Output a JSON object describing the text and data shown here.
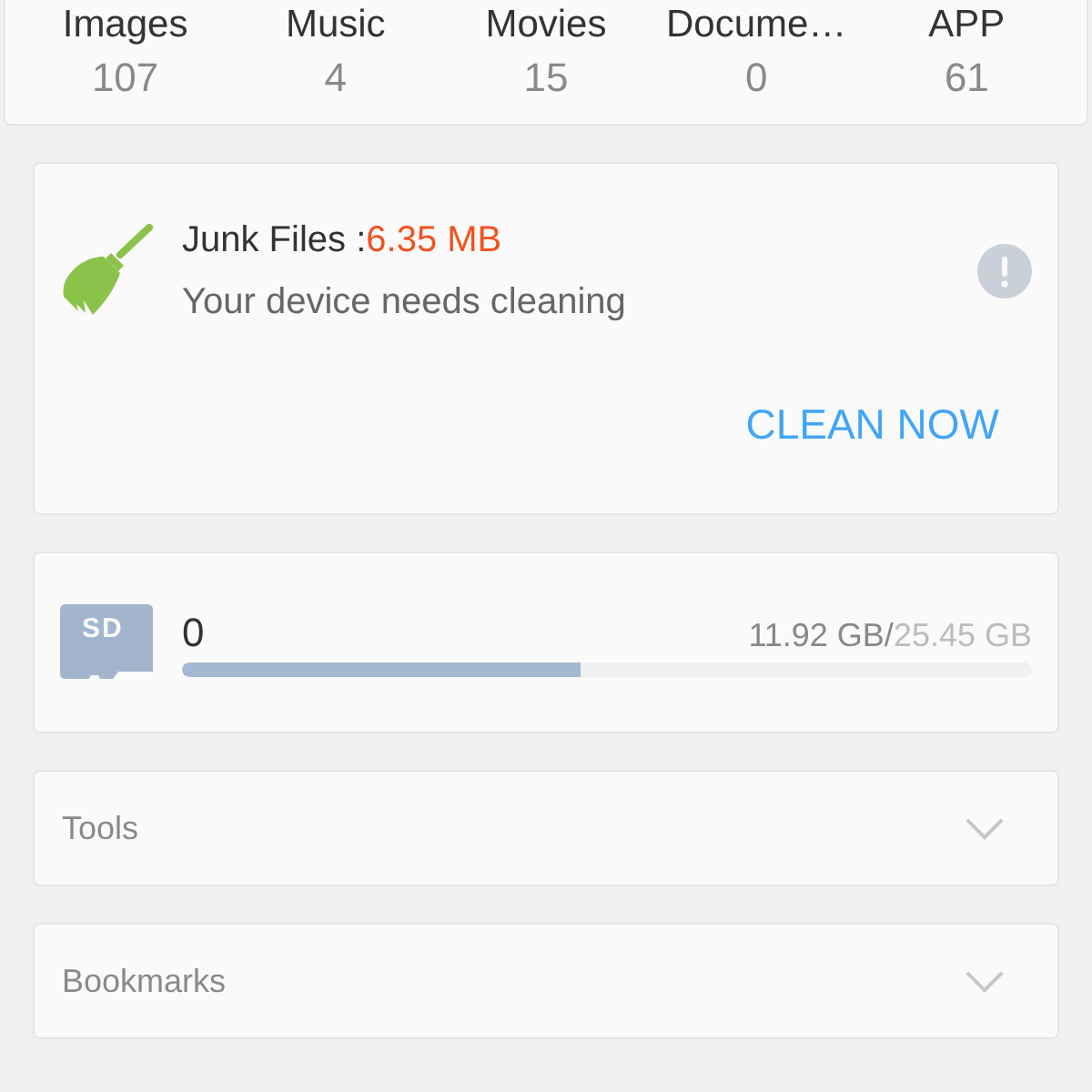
{
  "categories": [
    {
      "label": "Images",
      "count": "107"
    },
    {
      "label": "Music",
      "count": "4"
    },
    {
      "label": "Movies",
      "count": "15"
    },
    {
      "label": "Docume…",
      "count": "0"
    },
    {
      "label": "APP",
      "count": "61"
    }
  ],
  "junk_card": {
    "title": "Junk Files :",
    "size": "6.35 MB",
    "message": "Your device needs cleaning",
    "action": "CLEAN NOW"
  },
  "storage": {
    "badge": "SD",
    "name": "0",
    "used": "11.92 GB/",
    "total": "25.45 GB",
    "level": 0.468
  },
  "sections": [
    {
      "label": "Tools",
      "expanded": false
    },
    {
      "label": "Bookmarks",
      "expanded": false
    }
  ]
}
